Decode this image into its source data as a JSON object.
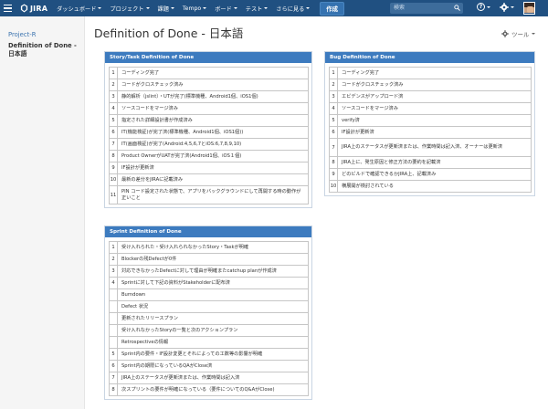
{
  "nav": {
    "logo": "JIRA",
    "items": [
      "ダッシュボード",
      "プロジェクト",
      "課題",
      "Tempo",
      "ボード",
      "テスト",
      "さらに見る"
    ],
    "create": "作成",
    "search_placeholder": "検索",
    "help_glyph": "?"
  },
  "sidebar": {
    "project": "Project-R",
    "current_page": "Definition of Done - 日本語"
  },
  "page": {
    "title": "Definition of Done - 日本語",
    "tools": "ツール"
  },
  "story_panel": {
    "title": "Story/Task Definition of Done",
    "rows": [
      {
        "n": "1",
        "text": "コーディング完了"
      },
      {
        "n": "2",
        "text": "コードがクロスチェック済み"
      },
      {
        "n": "3",
        "text": "静的解析（jslint）・UTが完了(標準機種、Android1個、iOS1個)"
      },
      {
        "n": "4",
        "text": "ソースコードをマージ済み"
      },
      {
        "n": "5",
        "text": "指定された詳細設計書が作成済み"
      },
      {
        "n": "6",
        "text": "IT(機能検証)が完了済(標準機種、Android1個、iOS1個))"
      },
      {
        "n": "7",
        "text": "IT(画面検証)が完了(Android:4,5,6,7とiOS:6,7,8,9,10)"
      },
      {
        "n": "8",
        "text": "Product OwnerがUATが完了済(Android1個、iOS１個)"
      },
      {
        "n": "9",
        "text": "IF設計が更新済"
      },
      {
        "n": "10",
        "text": "最新の差分をJIRAに記載済み"
      },
      {
        "n": "11",
        "text": "PIN コード設定された状態で、アプリをバックグラウンドにして再開する時の動作が正いこと"
      }
    ]
  },
  "bug_panel": {
    "title": "Bug Definition of Done",
    "rows": [
      {
        "n": "1",
        "text": "コーディング完了"
      },
      {
        "n": "2",
        "text": "コードがクロスチェック済み"
      },
      {
        "n": "3",
        "text": "エビデンスがアップロード済"
      },
      {
        "n": "4",
        "text": "ソースコードをマージ済み"
      },
      {
        "n": "5",
        "text": "verify済"
      },
      {
        "n": "6",
        "text": "IF設計が更新済"
      },
      {
        "n": "7",
        "text": "JIRA上のステータスが更新済または、作業時間は記入済、オーナーは更新済"
      },
      {
        "n": "8",
        "text": "JIRA上に、発生原因と修正方法の要約を記載済"
      },
      {
        "n": "9",
        "text": "どのビルドで確認できるかJIRA上、記載済み"
      },
      {
        "n": "10",
        "text": "横展開が検討されている"
      }
    ]
  },
  "sprint_panel": {
    "title": "Sprint Definition of Done",
    "rows": [
      {
        "n": "1",
        "text": "受け入れられた・受け入れられなかったStory・Taskが明確"
      },
      {
        "n": "2",
        "text": "Blockerの残Defectが0件"
      },
      {
        "n": "3",
        "text": "対応できなかったDefectに対して理由が明確またcatchup planが作成済"
      },
      {
        "n": "4",
        "text": "Sprintに対して下記の資料がStakeholderに配布済"
      },
      {
        "n": "",
        "text": "Burndown"
      },
      {
        "n": "",
        "text": "Defect 状況"
      },
      {
        "n": "",
        "text": "更新されたリリースプラン"
      },
      {
        "n": "",
        "text": "受け入れなかったStoryの一覧と次のアクションプラン"
      },
      {
        "n": "",
        "text": "Retrospectiveの情報"
      },
      {
        "n": "5",
        "text": "Sprint内の要件・IF設計変更とそれによっての工数等の影響が明確"
      },
      {
        "n": "6",
        "text": "Sprint内の期限になっているQAがClose済"
      },
      {
        "n": "7",
        "text": "JIRA上のステータスが更新済または、作業時間は記入済"
      },
      {
        "n": "8",
        "text": "次スプリントの要件が明確になっている（要件についてのQ&AがClose)"
      }
    ]
  }
}
